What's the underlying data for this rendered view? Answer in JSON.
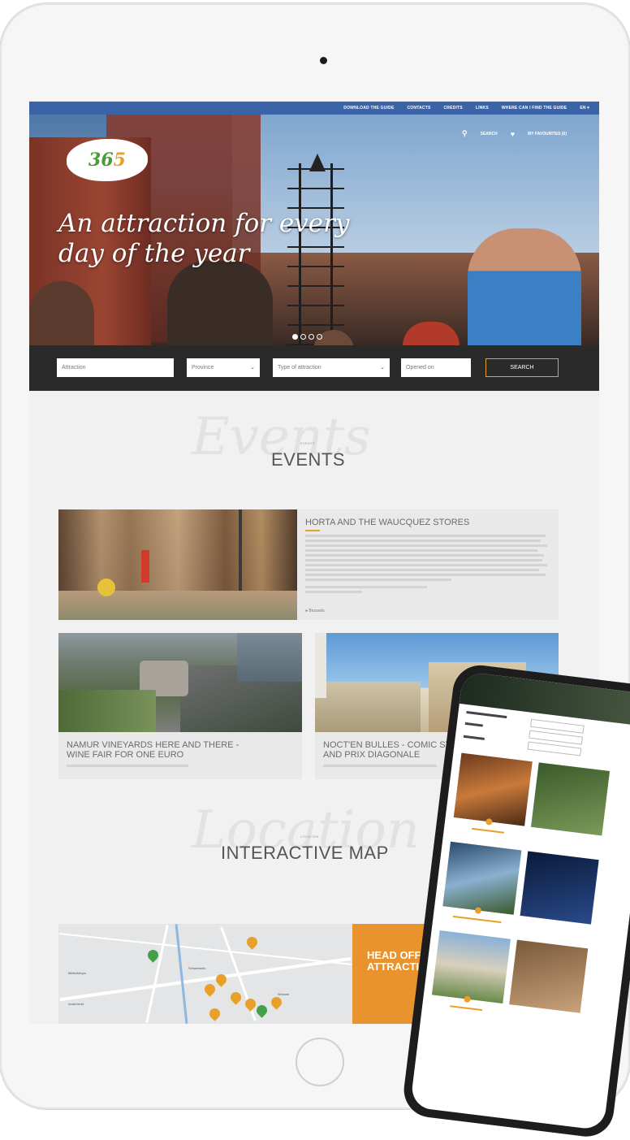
{
  "topnav": {
    "items": [
      "DOWNLOAD THE GUIDE",
      "CONTACTS",
      "CREDITS",
      "LINKS",
      "WHERE CAN I FIND THE GUIDE",
      "EN ▾"
    ]
  },
  "utility": {
    "search_label": "SEARCH",
    "favourites_label": "MY FAVOURITES (0)"
  },
  "hero": {
    "logo_text_a": "36",
    "logo_text_b": "5",
    "title_line1": "An attraction for every",
    "title_line2": "day of the year"
  },
  "search_form": {
    "attraction_placeholder": "Attraction",
    "province_value": "Province",
    "type_value": "Type of attraction",
    "opened_on_placeholder": "Opened on",
    "submit_label": "SEARCH"
  },
  "events": {
    "bg_word": "Events",
    "label": "EVENTS",
    "title": "EVENTS",
    "featured": {
      "title": "HORTA AND THE WAUCQUEZ STORES",
      "location": "Brussels"
    },
    "cards": [
      {
        "title_line1": "NAMUR VINEYARDS HERE AND THERE -",
        "title_line2": "WINE FAIR FOR ONE EURO"
      },
      {
        "title_line1": "NOCT'EN BULLES - COMIC STRIP FESTIVAL",
        "title_line2": "AND PRIX DIAGONALE"
      }
    ]
  },
  "map_section": {
    "bg_word": "Location",
    "label": "LOCATION",
    "title": "INTERACTIVE MAP",
    "promo_line1": "HEAD OFF TO DISCOVER",
    "promo_line2": "ATTRACTIONS NEAR YOU"
  },
  "colors": {
    "topbar": "#3b63a8",
    "accent": "#e8a02a",
    "searchbar": "#2a2a2a",
    "promo": "#e8932e"
  },
  "icons": [
    "search-icon",
    "heart-icon",
    "chevron-down-icon",
    "map-pin-icon",
    "location-icon"
  ]
}
